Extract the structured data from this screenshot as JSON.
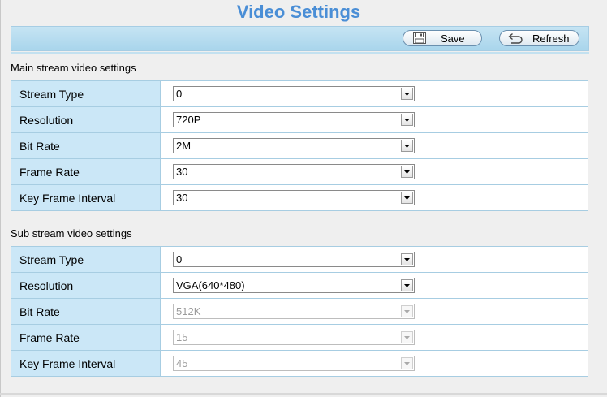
{
  "page": {
    "title": "Video Settings"
  },
  "toolbar": {
    "save_label": "Save",
    "refresh_label": "Refresh"
  },
  "main": {
    "heading": "Main stream video settings",
    "rows": [
      {
        "label": "Stream Type",
        "value": "0",
        "enabled": true
      },
      {
        "label": "Resolution",
        "value": "720P",
        "enabled": true
      },
      {
        "label": "Bit Rate",
        "value": "2M",
        "enabled": true
      },
      {
        "label": "Frame Rate",
        "value": "30",
        "enabled": true
      },
      {
        "label": "Key Frame Interval",
        "value": "30",
        "enabled": true
      }
    ]
  },
  "sub": {
    "heading": "Sub stream video settings",
    "rows": [
      {
        "label": "Stream Type",
        "value": "0",
        "enabled": true
      },
      {
        "label": "Resolution",
        "value": "VGA(640*480)",
        "enabled": true
      },
      {
        "label": "Bit Rate",
        "value": "512K",
        "enabled": false
      },
      {
        "label": "Frame Rate",
        "value": "15",
        "enabled": false
      },
      {
        "label": "Key Frame Interval",
        "value": "45",
        "enabled": false
      }
    ]
  },
  "colors": {
    "title": "#4a8ed6",
    "label_cell": "#cbe7f7",
    "border": "#a7cde2"
  },
  "icons": {
    "save": "floppy-disk-icon",
    "refresh": "undo-arrow-icon",
    "dropdown": "dropdown-arrow-icon"
  }
}
